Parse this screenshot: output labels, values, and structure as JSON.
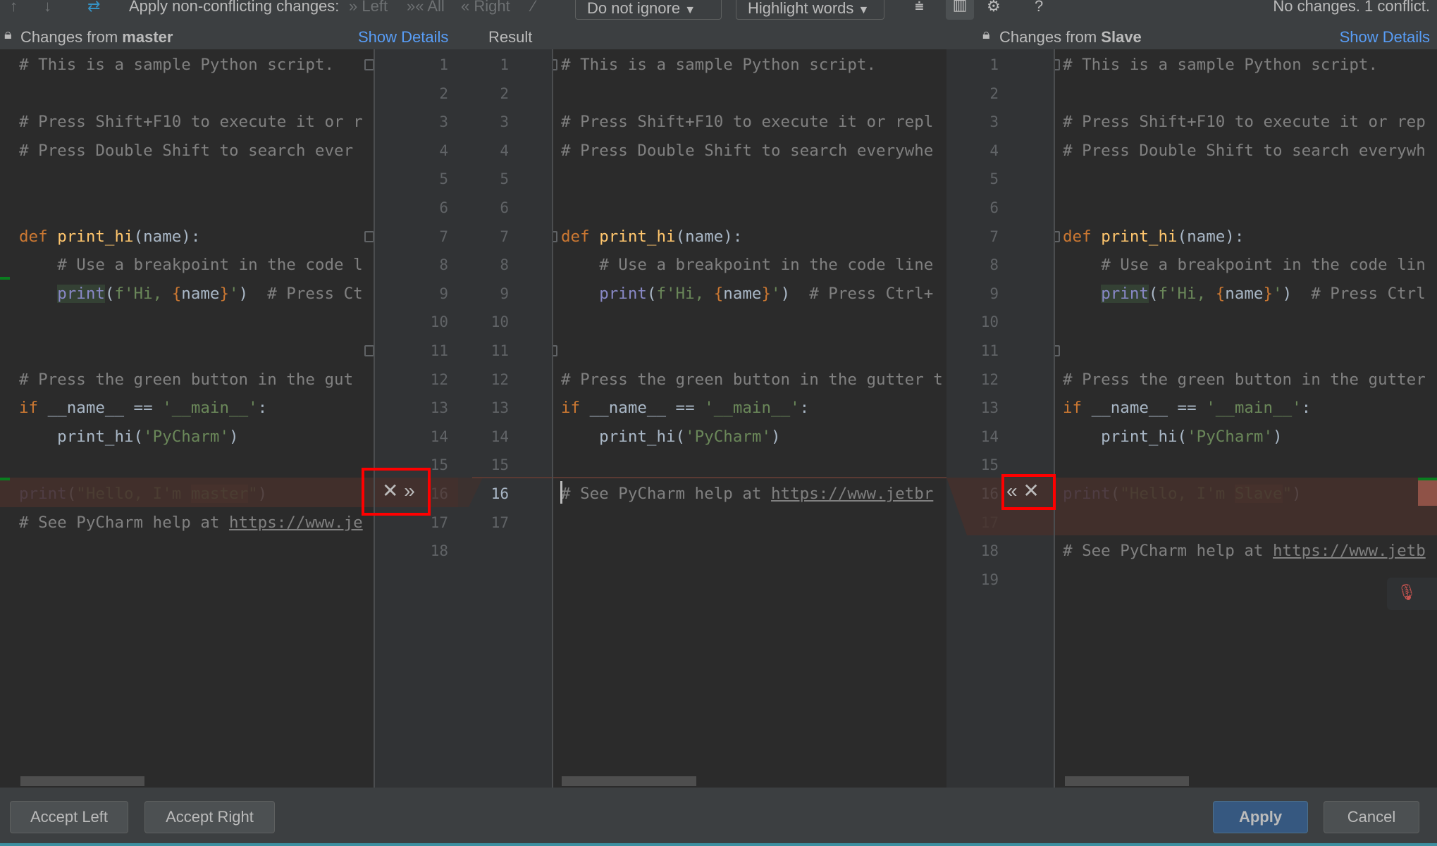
{
  "toolbar": {
    "apply_label": "Apply non-conflicting changes:",
    "left": "Left",
    "all": "All",
    "right": "Right",
    "ignore_dropdown": "Do not ignore",
    "highlight_dropdown": "Highlight words",
    "help": "?",
    "status": "No changes. 1 conflict.",
    "icons": [
      "arrow-up-icon",
      "arrow-down-icon",
      "magic-resolve-icon",
      "collapse-icon",
      "sync-scroll-icon",
      "gear-icon"
    ]
  },
  "header": {
    "left_title_prefix": "Changes from ",
    "left_branch": "master",
    "left_details": "Show Details",
    "center_title": "Result",
    "right_title_prefix": "Changes from ",
    "right_branch": "Slave",
    "right_details": "Show Details"
  },
  "left_pane": {
    "line_count": 18,
    "lines": {
      "1": [
        [
          "# This is a sample Python script.",
          "cm"
        ]
      ],
      "3": [
        [
          "# Press Shift+F10 to execute it or r",
          "cm"
        ]
      ],
      "4": [
        [
          "# Press Double Shift to search ever",
          "cm"
        ]
      ],
      "7": [
        [
          "def ",
          "kw"
        ],
        [
          "print_hi",
          "fn"
        ],
        [
          "(name):",
          ""
        ]
      ],
      "8": [
        [
          "    ",
          ""
        ],
        [
          "# Use a breakpoint in the code l",
          "cm"
        ]
      ],
      "9": [
        [
          "    ",
          ""
        ],
        [
          "print",
          "bi hl"
        ],
        [
          "(",
          ""
        ],
        [
          "f'Hi, ",
          "st"
        ],
        [
          "{",
          "br"
        ],
        [
          "name",
          ""
        ],
        [
          "}",
          "br"
        ],
        [
          "'",
          "st"
        ],
        [
          ")  ",
          ""
        ],
        [
          "# Press Ct",
          "cm"
        ]
      ],
      "12": [
        [
          "# Press the green button in the gut",
          "cm"
        ]
      ],
      "13": [
        [
          "if ",
          "kw"
        ],
        [
          "__name__ == ",
          ""
        ],
        [
          "'__main__'",
          "st"
        ],
        [
          ":",
          ""
        ]
      ],
      "14": [
        [
          "    print_hi(",
          ""
        ],
        [
          "'PyCharm'",
          "st"
        ],
        [
          ")",
          ""
        ]
      ],
      "16": [
        [
          "print",
          "bi"
        ],
        [
          "(",
          ""
        ],
        [
          "\"Hello, I'm ",
          "st"
        ],
        [
          "master",
          "st wd"
        ],
        [
          "\"",
          "st"
        ],
        [
          ")",
          ""
        ]
      ],
      "17": [
        [
          "# See PyCharm help at ",
          "cm"
        ],
        [
          "https://www.je",
          "cm ul"
        ]
      ]
    }
  },
  "center_pane": {
    "line_count": 17,
    "lines": {
      "1": [
        [
          "# This is a sample Python script.",
          "cm"
        ]
      ],
      "3": [
        [
          "# Press Shift+F10 to execute it or repl",
          "cm"
        ]
      ],
      "4": [
        [
          "# Press Double Shift to search everywhe",
          "cm"
        ]
      ],
      "7": [
        [
          "def ",
          "kw"
        ],
        [
          "print_hi",
          "fn"
        ],
        [
          "(name):",
          ""
        ]
      ],
      "8": [
        [
          "    ",
          ""
        ],
        [
          "# Use a breakpoint in the code line",
          "cm"
        ]
      ],
      "9": [
        [
          "    ",
          ""
        ],
        [
          "print",
          "bi"
        ],
        [
          "(",
          ""
        ],
        [
          "f'Hi, ",
          "st"
        ],
        [
          "{",
          "br"
        ],
        [
          "name",
          ""
        ],
        [
          "}",
          "br"
        ],
        [
          "'",
          "st"
        ],
        [
          ")  ",
          ""
        ],
        [
          "# Press Ctrl+",
          "cm"
        ]
      ],
      "12": [
        [
          "# Press the green button in the gutter t",
          "cm"
        ]
      ],
      "13": [
        [
          "if ",
          "kw"
        ],
        [
          "__name__ == ",
          ""
        ],
        [
          "'__main__'",
          "st"
        ],
        [
          ":",
          ""
        ]
      ],
      "14": [
        [
          "    print_hi(",
          ""
        ],
        [
          "'PyCharm'",
          "st"
        ],
        [
          ")",
          ""
        ]
      ],
      "16": [
        [
          "# See PyCharm help at ",
          "cm"
        ],
        [
          "https://www.jetbr",
          "cm ul"
        ]
      ]
    }
  },
  "right_pane": {
    "line_count": 19,
    "lines": {
      "1": [
        [
          "# This is a sample Python script.",
          "cm"
        ]
      ],
      "3": [
        [
          "# Press Shift+F10 to execute it or rep",
          "cm"
        ]
      ],
      "4": [
        [
          "# Press Double Shift to search everywh",
          "cm"
        ]
      ],
      "7": [
        [
          "def ",
          "kw"
        ],
        [
          "print_hi",
          "fn"
        ],
        [
          "(name):",
          ""
        ]
      ],
      "8": [
        [
          "    ",
          ""
        ],
        [
          "# Use a breakpoint in the code lin",
          "cm"
        ]
      ],
      "9": [
        [
          "    ",
          ""
        ],
        [
          "print",
          "bi hl"
        ],
        [
          "(",
          ""
        ],
        [
          "f'Hi, ",
          "st"
        ],
        [
          "{",
          "br"
        ],
        [
          "name",
          ""
        ],
        [
          "}",
          "br"
        ],
        [
          "'",
          "st"
        ],
        [
          ")  ",
          ""
        ],
        [
          "# Press Ctrl",
          "cm"
        ]
      ],
      "12": [
        [
          "# Press the green button in the gutter",
          "cm"
        ]
      ],
      "13": [
        [
          "if ",
          "kw"
        ],
        [
          "__name__ == ",
          ""
        ],
        [
          "'__main__'",
          "st"
        ],
        [
          ":",
          ""
        ]
      ],
      "14": [
        [
          "    print_hi(",
          ""
        ],
        [
          "'PyCharm'",
          "st"
        ],
        [
          ")",
          ""
        ]
      ],
      "16": [
        [
          "print",
          "bi"
        ],
        [
          "(",
          ""
        ],
        [
          "\"Hello, I'm ",
          "st"
        ],
        [
          "Slave",
          "st wd"
        ],
        [
          "\"",
          "st"
        ],
        [
          ")",
          ""
        ]
      ],
      "18": [
        [
          "# See PyCharm help at ",
          "cm"
        ],
        [
          "https://www.jetb",
          "cm ul"
        ]
      ]
    }
  },
  "conflict": {
    "line": 16,
    "left_actions": [
      "ignore-icon",
      "accept-right-arrow-icon"
    ],
    "right_actions": [
      "accept-left-arrow-icon",
      "ignore-icon"
    ]
  },
  "buttons": {
    "accept_left": "Accept Left",
    "accept_right": "Accept Right",
    "apply": "Apply",
    "cancel": "Cancel"
  },
  "colors": {
    "accent": "#365880",
    "link": "#589df6",
    "conflict_bg": "#45302b",
    "highlight_box": "#ff0000"
  }
}
